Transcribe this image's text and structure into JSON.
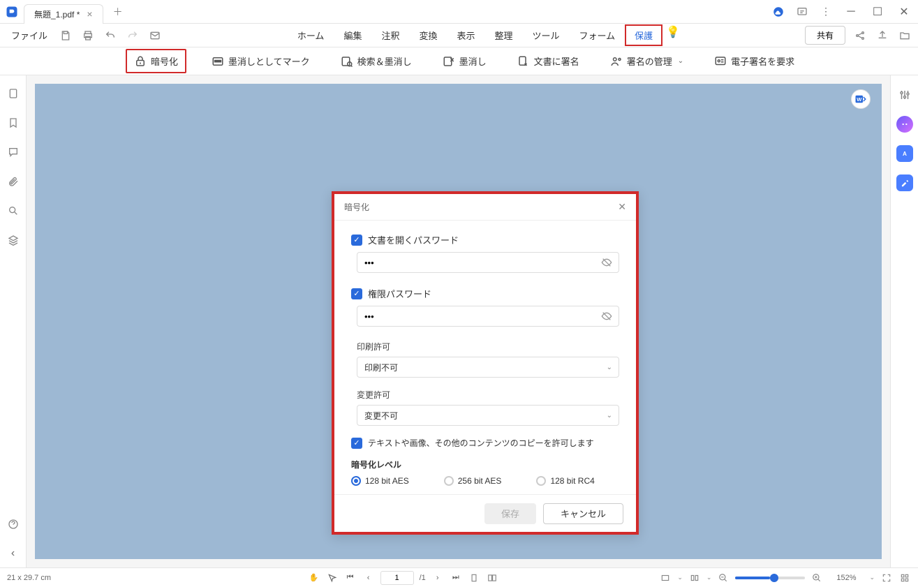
{
  "titlebar": {
    "tab_name": "無題_1.pdf *"
  },
  "menubar": {
    "file": "ファイル",
    "tabs": [
      "ホーム",
      "編集",
      "注釈",
      "変換",
      "表示",
      "整理",
      "ツール",
      "フォーム",
      "保護"
    ],
    "active_index": 8,
    "share": "共有"
  },
  "ribbon": {
    "encrypt": "暗号化",
    "mark_redact": "墨消しとしてマーク",
    "search_redact": "検索＆墨消し",
    "apply_redact": "墨消し",
    "sign_doc": "文書に署名",
    "manage_sig": "署名の管理",
    "request_esign": "電子署名を要求"
  },
  "dialog": {
    "title": "暗号化",
    "open_pwd_label": "文書を開くパスワード",
    "open_pwd_value": "•••",
    "perm_pwd_label": "権限パスワード",
    "perm_pwd_value": "•••",
    "print_label": "印刷許可",
    "print_value": "印刷不可",
    "change_label": "変更許可",
    "change_value": "変更不可",
    "copy_label": "テキストや画像、その他のコンテンツのコピーを許可します",
    "enc_level_label": "暗号化レベル",
    "enc_options": [
      "128 bit AES",
      "256 bit AES",
      "128 bit RC4"
    ],
    "enc_selected": 0,
    "save": "保存",
    "cancel": "キャンセル"
  },
  "statusbar": {
    "dims": "21 x 29.7 cm",
    "page": "1",
    "total": "/1",
    "zoom": "152%"
  }
}
